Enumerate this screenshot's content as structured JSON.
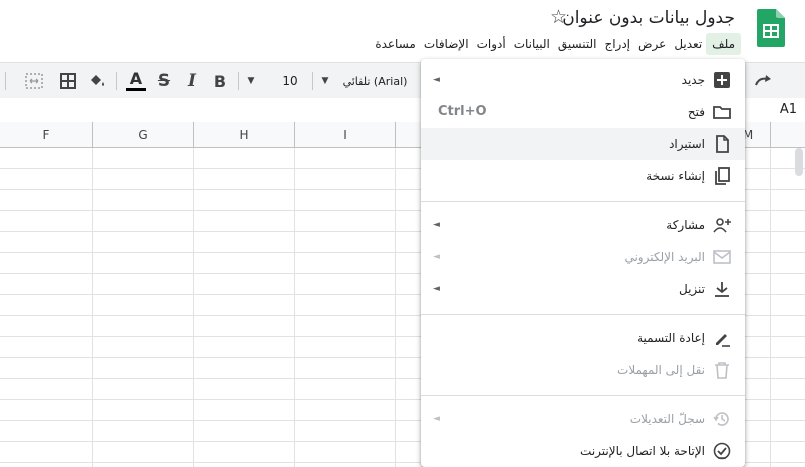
{
  "header": {
    "doc_title": "جدول بيانات بدون عنوان",
    "menu": [
      "ملف",
      "تعديل",
      "عرض",
      "إدراج",
      "التنسيق",
      "البيانات",
      "أدوات",
      "الإضافات",
      "مساعدة"
    ],
    "active_menu": "ملف",
    "colors": {
      "sheets_green": "#23a566",
      "menu_active_bg": "#e2f0e6"
    }
  },
  "toolbar": {
    "font_name": "تلقائي (Arial)",
    "font_size": "10",
    "redo_icon": "redo-icon",
    "text_color_swatch": "#000000"
  },
  "formula_bar": {
    "cell_ref": "A1"
  },
  "grid": {
    "columns": [
      "F",
      "G",
      "H",
      "I",
      "M"
    ]
  },
  "file_menu": {
    "items": [
      {
        "label": "جديد",
        "icon": "plus-box-icon",
        "submenu": true,
        "disabled": false
      },
      {
        "label": "فتح",
        "icon": "folder-icon",
        "shortcut": "Ctrl+O",
        "disabled": false
      },
      {
        "label": "استيراد",
        "icon": "file-icon",
        "disabled": false
      },
      {
        "label": "إنشاء نسخة",
        "icon": "copy-icon",
        "disabled": false
      },
      {
        "label": "مشاركة",
        "icon": "person-add-icon",
        "submenu": true,
        "disabled": false
      },
      {
        "label": "البريد الإلكتروني",
        "icon": "mail-icon",
        "submenu": true,
        "disabled": true
      },
      {
        "label": "تنزيل",
        "icon": "download-icon",
        "submenu": true,
        "disabled": false
      },
      {
        "label": "إعادة التسمية",
        "icon": "rename-icon",
        "disabled": false
      },
      {
        "label": "نقل إلى المهملات",
        "icon": "trash-icon",
        "disabled": true
      },
      {
        "label": "سجلّ التعديلات",
        "icon": "history-icon",
        "submenu": true,
        "disabled": true
      },
      {
        "label": "الإتاحة بلا اتصال بالإنترنت",
        "icon": "offline-check-icon",
        "disabled": false
      }
    ]
  }
}
